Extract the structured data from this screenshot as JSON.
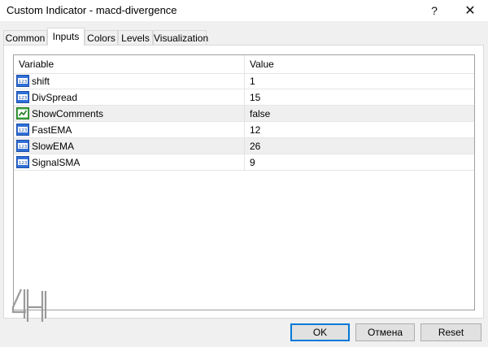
{
  "window": {
    "title": "Custom Indicator - macd-divergence",
    "help_label": "?",
    "close_label": "✕"
  },
  "tabs": [
    {
      "label": "Common",
      "active": false
    },
    {
      "label": "Inputs",
      "active": true
    },
    {
      "label": "Colors",
      "active": false
    },
    {
      "label": "Levels",
      "active": false
    },
    {
      "label": "Visualization",
      "active": false
    }
  ],
  "grid": {
    "columns": [
      "Variable",
      "Value"
    ],
    "rows": [
      {
        "name": "shift",
        "value": "1",
        "icon": "integer-icon"
      },
      {
        "name": "DivSpread",
        "value": "15",
        "icon": "integer-icon"
      },
      {
        "name": "ShowComments",
        "value": "false",
        "icon": "boolean-icon"
      },
      {
        "name": "FastEMA",
        "value": "12",
        "icon": "integer-icon"
      },
      {
        "name": "SlowEMA",
        "value": "26",
        "icon": "integer-icon"
      },
      {
        "name": "SignalSMA",
        "value": "9",
        "icon": "integer-icon"
      }
    ]
  },
  "buttons": {
    "ok": "OK",
    "cancel": "Отмена",
    "reset": "Reset"
  },
  "colors": {
    "accent": "#0078d7",
    "row_alt": "#efefef"
  }
}
